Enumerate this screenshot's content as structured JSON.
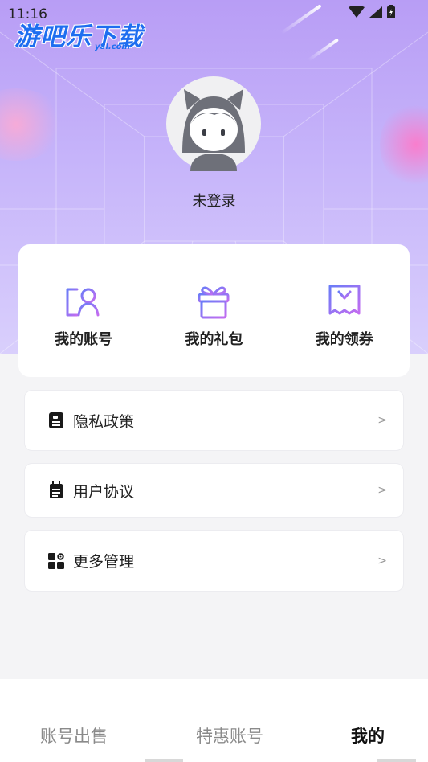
{
  "status_bar": {
    "time": "11:16",
    "icons": [
      "wifi-icon",
      "signal-icon",
      "battery-icon"
    ]
  },
  "watermark": {
    "logo_text": "游吧乐下载",
    "logo_sub": "y8l.com"
  },
  "profile": {
    "username": "未登录",
    "avatar_icon": "default-avatar-icon"
  },
  "quick_actions": [
    {
      "label": "我的账号",
      "icon": "account-icon"
    },
    {
      "label": "我的礼包",
      "icon": "gift-icon"
    },
    {
      "label": "我的领券",
      "icon": "coupon-icon"
    }
  ],
  "menu": [
    {
      "label": "隐私政策",
      "icon": "privacy-icon",
      "arrow": ">"
    },
    {
      "label": "用户协议",
      "icon": "agreement-icon",
      "arrow": ">"
    },
    {
      "label": "更多管理",
      "icon": "more-manage-icon",
      "arrow": ">"
    }
  ],
  "tabs": [
    {
      "label": "账号出售",
      "active": false
    },
    {
      "label": "特惠账号",
      "active": false
    },
    {
      "label": "我的",
      "active": true
    }
  ],
  "colors": {
    "accent_gradient_start": "#7b6cf6",
    "accent_gradient_end": "#c46cf0",
    "hero_top": "#b89df5",
    "logo_blue": "#1e6ef0"
  }
}
